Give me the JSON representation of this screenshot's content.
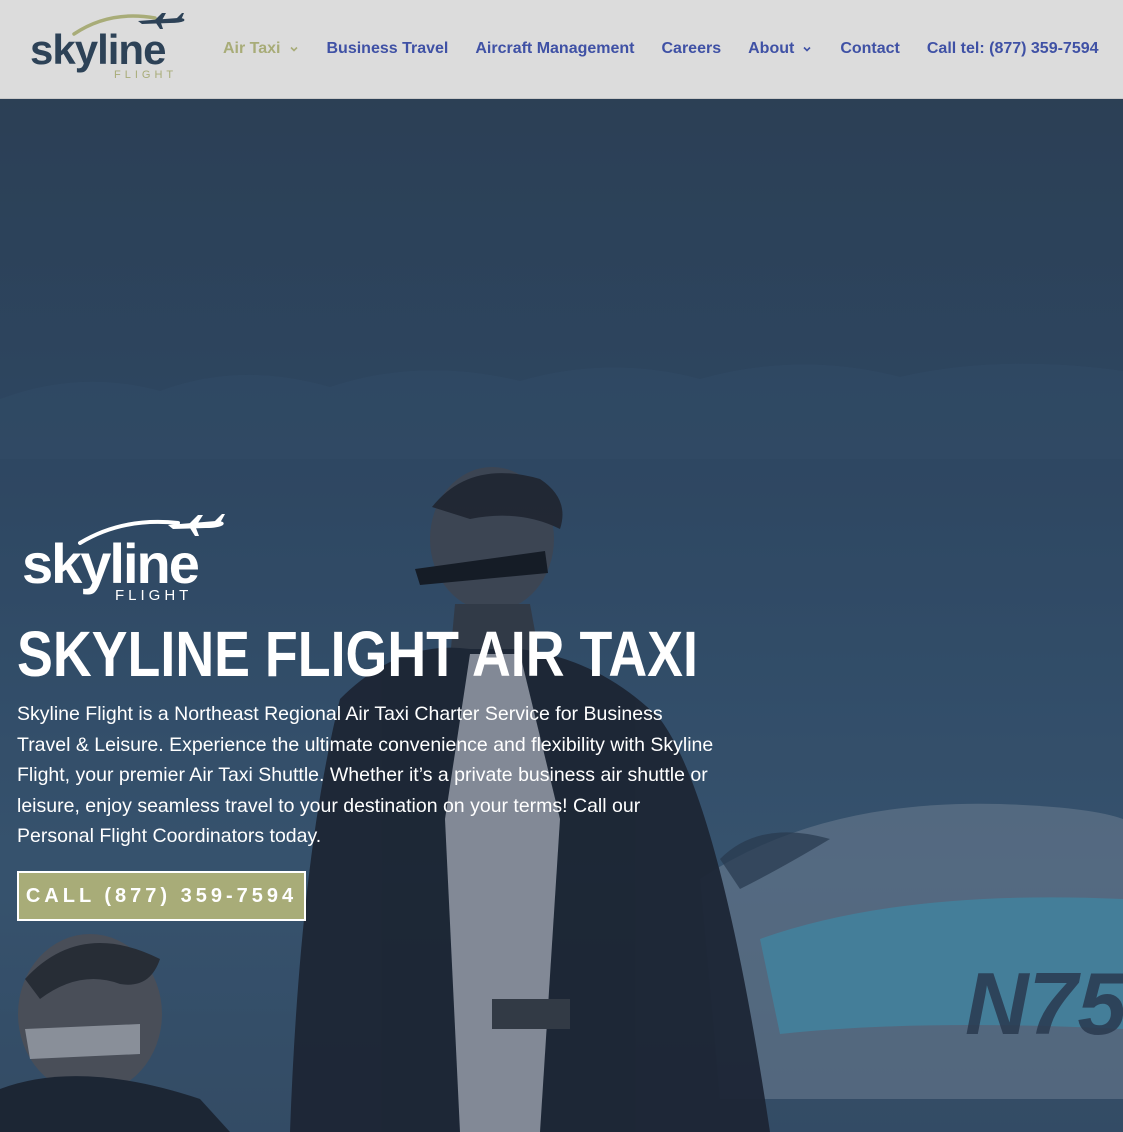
{
  "brand": {
    "name_main": "skyline",
    "name_sub": "FLIGHT",
    "colors": {
      "navy": "#2d4257",
      "olive": "#a8ac78",
      "nav_blue": "#3f51a5"
    }
  },
  "nav": {
    "items": [
      {
        "label": "Air Taxi",
        "has_dropdown": true,
        "active": true
      },
      {
        "label": "Business Travel",
        "has_dropdown": false
      },
      {
        "label": "Aircraft Management",
        "has_dropdown": false
      },
      {
        "label": "Careers",
        "has_dropdown": false
      },
      {
        "label": "About",
        "has_dropdown": true
      },
      {
        "label": "Contact",
        "has_dropdown": false
      },
      {
        "label": "Call tel: (877) 359-7594",
        "has_dropdown": false
      }
    ]
  },
  "hero": {
    "logo_main": "skyline",
    "logo_sub": "FLIGHT",
    "title": "SKYLINE FLIGHT AIR TAXI",
    "paragraph": "Skyline Flight is a Northeast Regional Air Taxi Charter Service for Business Travel & Leisure. Experience the ultimate convenience and flexibility with Skyline Flight, your premier Air Taxi Shuttle. Whether it’s a private business air shuttle or leisure, enjoy seamless travel to your destination on your terms! Call our Personal Flight Coordinators today.",
    "cta_label": "CALL (877) 359-7594",
    "aircraft_tail": "N75"
  }
}
